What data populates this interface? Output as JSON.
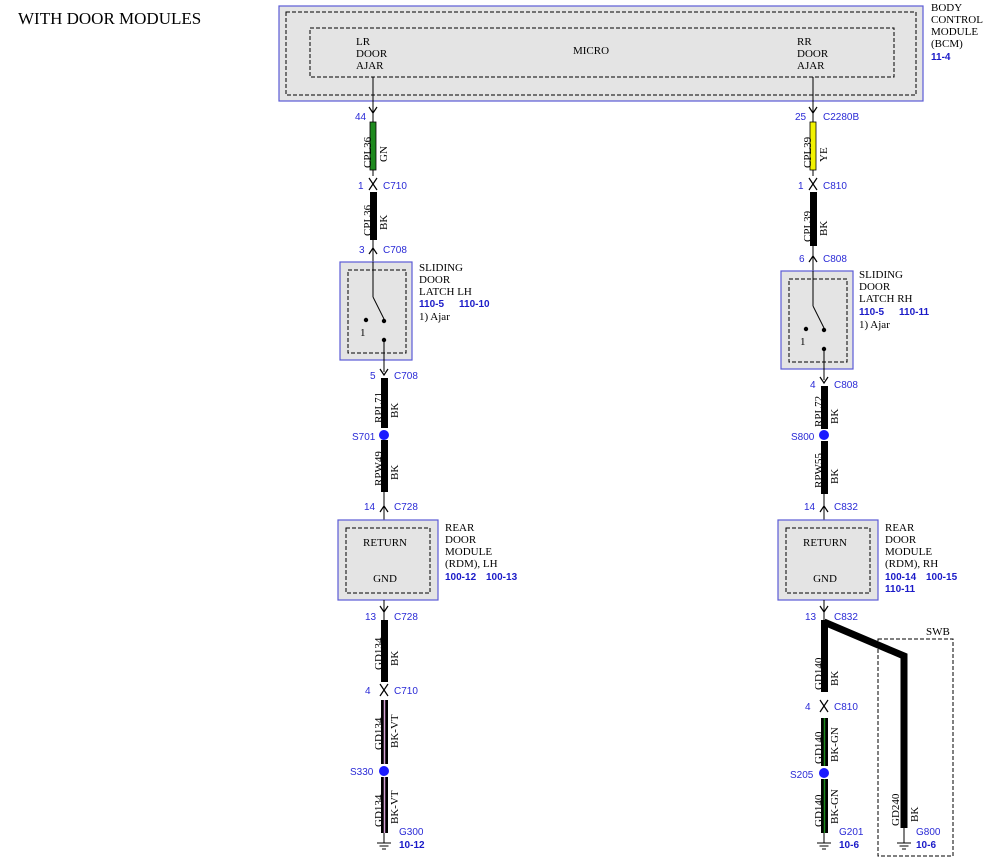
{
  "title": "WITH DOOR MODULES",
  "bcm": {
    "name_lines": [
      "BODY",
      "CONTROL",
      "MODULE",
      "(BCM)"
    ],
    "ref": "11-4",
    "micro": "MICRO",
    "lr_lines": [
      "LR",
      "DOOR",
      "AJAR"
    ],
    "rr_lines": [
      "RR",
      "DOOR",
      "AJAR"
    ]
  },
  "left": {
    "pin_bcm": "44",
    "c1_pin": "1",
    "c1": "C710",
    "c2_pin": "3",
    "c2": "C708",
    "c3_pin": "5",
    "c3": "C708",
    "splice1": "S701",
    "c4_pin": "14",
    "c4": "C728",
    "c5_pin": "13",
    "c5": "C728",
    "c6_pin": "4",
    "c6": "C710",
    "splice2": "S330",
    "ground": "G300",
    "ground_ref": "10-12",
    "w1_circuit": "CPL36",
    "w1_color": "GN",
    "w2_circuit": "CPL36",
    "w2_color": "BK",
    "w3_circuit": "RPL71",
    "w3_color": "BK",
    "w4_circuit": "RPW49",
    "w4_color": "BK",
    "w5_circuit": "GD134",
    "w5_color": "BK",
    "w6_circuit": "GD134",
    "w6_color": "BK-VT",
    "w7_circuit": "GD134",
    "w7_color": "BK-VT",
    "latch_lines": [
      "SLIDING",
      "DOOR",
      "LATCH LH"
    ],
    "latch_refs": [
      "110-5",
      "110-10"
    ],
    "latch_note": "1) Ajar",
    "switch_num": "1",
    "rdm_lines": [
      "REAR",
      "DOOR",
      "MODULE",
      "(RDM), LH"
    ],
    "rdm_refs": [
      "100-12",
      "100-13"
    ],
    "return": "RETURN",
    "gnd": "GND"
  },
  "right": {
    "pin_bcm": "25",
    "bcm_conn": "C2280B",
    "c1_pin": "1",
    "c1": "C810",
    "c2_pin": "6",
    "c2": "C808",
    "c3_pin": "4",
    "c3": "C808",
    "splice1": "S800",
    "c4_pin": "14",
    "c4": "C832",
    "c5_pin": "13",
    "c5": "C832",
    "c6_pin": "4",
    "c6": "C810",
    "splice2": "S205",
    "ground": "G201",
    "ground_ref": "10-6",
    "ground2": "G800",
    "ground2_ref": "10-6",
    "swb": "SWB",
    "w1_circuit": "CPL39",
    "w1_color": "YE",
    "w2_circuit": "CPL39",
    "w2_color": "BK",
    "w3_circuit": "RPL72",
    "w3_color": "BK",
    "w4_circuit": "RPW55",
    "w4_color": "BK",
    "w5_circuit": "GD140",
    "w5_color": "BK",
    "w6_circuit": "GD140",
    "w6_color": "BK-GN",
    "w7_circuit": "GD140",
    "w7_color": "BK-GN",
    "w8_circuit": "GD240",
    "w8_color": "BK",
    "latch_lines": [
      "SLIDING",
      "DOOR",
      "LATCH RH"
    ],
    "latch_refs": [
      "110-5",
      "110-11"
    ],
    "latch_note": "1) Ajar",
    "switch_num": "1",
    "rdm_lines": [
      "REAR",
      "DOOR",
      "MODULE",
      "(RDM), RH"
    ],
    "rdm_refs": [
      "100-14",
      "100-15",
      "110-11"
    ],
    "return": "RETURN",
    "gnd": "GND"
  },
  "colors": {
    "module_fill": "#e4e4e4",
    "module_border": "#5b5bd6",
    "wire_black": "#000000",
    "wire_green": "#1e8a1e",
    "wire_yellow": "#f2f200",
    "splice": "#1a1aff",
    "tracer_violet": "#d7a6d7",
    "tracer_green": "#1e8a1e"
  }
}
